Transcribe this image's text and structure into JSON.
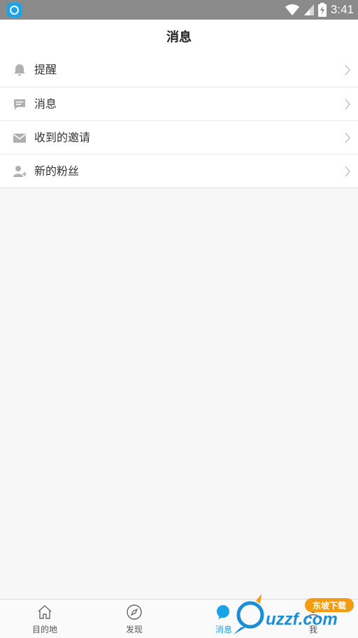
{
  "status_bar": {
    "time": "3:41"
  },
  "header": {
    "title": "消息"
  },
  "menu": {
    "items": [
      {
        "label": "提醒",
        "icon": "bell-icon"
      },
      {
        "label": "消息",
        "icon": "chat-bubble-icon"
      },
      {
        "label": "收到的邀请",
        "icon": "envelope-icon"
      },
      {
        "label": "新的粉丝",
        "icon": "add-user-icon"
      }
    ]
  },
  "tab_bar": {
    "tabs": [
      {
        "label": "目的地",
        "icon": "home-icon"
      },
      {
        "label": "发现",
        "icon": "compass-icon"
      },
      {
        "label": "消息",
        "icon": "chat-icon",
        "active": true
      },
      {
        "label": "我",
        "icon": "person-icon"
      }
    ]
  },
  "watermark": {
    "text": "uzzf.com",
    "tagline": "东坡下载"
  },
  "colors": {
    "accent": "#1aa3e8",
    "status_bar": "#8a8a8a",
    "icon_gray": "#b0b0b0"
  }
}
